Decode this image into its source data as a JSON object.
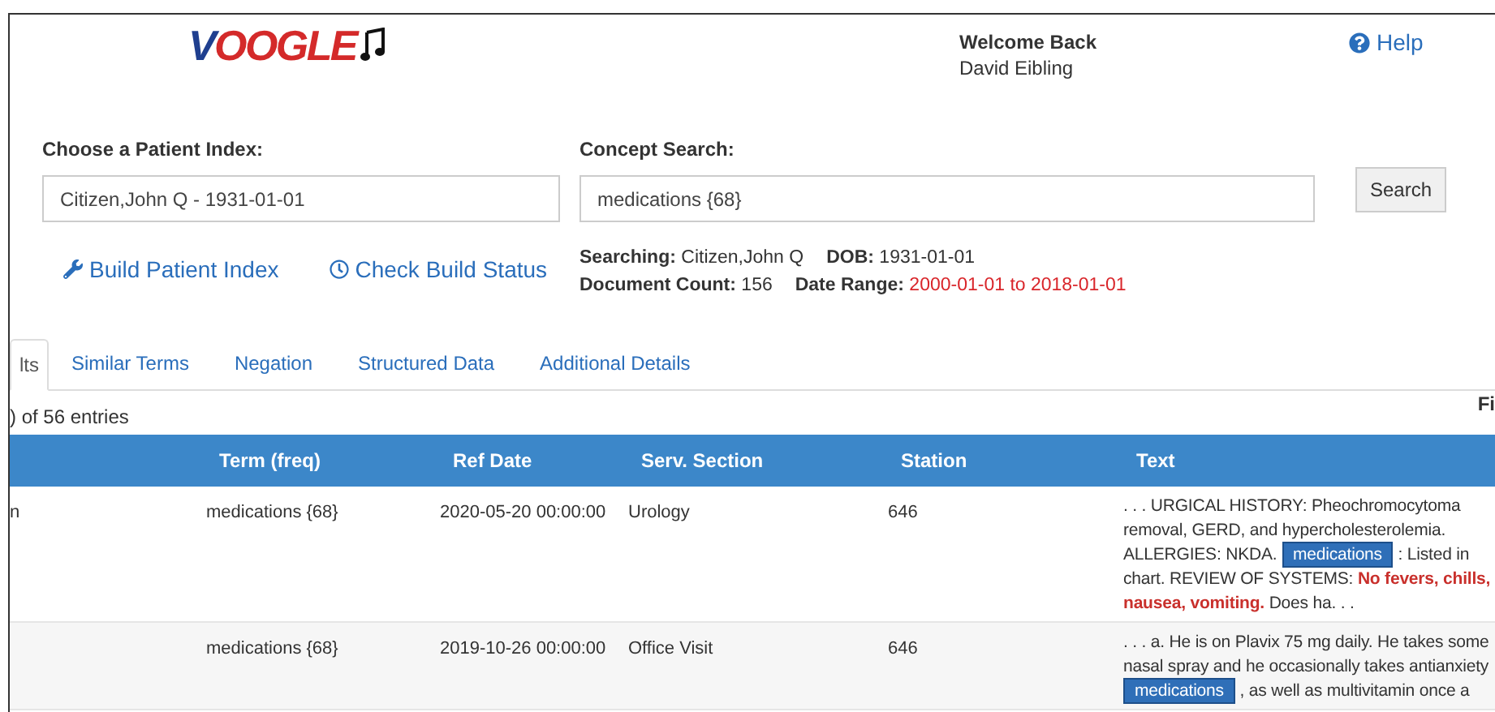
{
  "logo": {
    "text": "VOOGLE"
  },
  "user": {
    "greeting": "Welcome Back",
    "name": "David Eibling"
  },
  "help_link": "Help",
  "patient_index": {
    "label": "Choose a Patient Index:",
    "value": "Citizen,John Q - 1931-01-01"
  },
  "concept_search": {
    "label": "Concept Search:",
    "value": "medications {68}",
    "button": "Search"
  },
  "actions": [
    {
      "kind": "wrench",
      "label": "Build Patient Index"
    },
    {
      "kind": "clock",
      "label": "Check Build Status"
    }
  ],
  "search_info": [
    [
      {
        "label": "Searching:",
        "value": "Citizen,John Q",
        "alert": false
      },
      {
        "label": "DOB:",
        "value": "1931-01-01",
        "alert": false
      }
    ],
    [
      {
        "label": "Document Count:",
        "value": "156",
        "alert": false
      },
      {
        "label": "Date Range:",
        "value": "2000-01-01 to 2018-01-01",
        "alert": true
      }
    ]
  ],
  "tabs": [
    {
      "label": "lts",
      "selected": true
    },
    {
      "label": "Similar Terms",
      "selected": false
    },
    {
      "label": "Negation",
      "selected": false
    },
    {
      "label": "Structured Data",
      "selected": false
    },
    {
      "label": "Additional Details",
      "selected": false
    }
  ],
  "table": {
    "info": ") of 56 entries",
    "filter_label": "Fi",
    "columns": [
      "Term (freq)",
      "Ref Date",
      "Serv. Section",
      "Station",
      "Text"
    ],
    "rows": [
      {
        "column_1": "n",
        "term": "medications {68}",
        "ref_date": "2020-05-20 00:00:00",
        "section": "Urology",
        "station": "646",
        "text": [
          {
            "kind": "plain",
            "text": ". . . URGICAL HISTORY: Pheochromocytoma removal, GERD, and hypercholesterolemia. ALLERGIES: NKDA."
          },
          {
            "kind": "match",
            "text": "medications"
          },
          {
            "kind": "plain",
            "text": ": Listed in chart. REVIEW OF SYSTEMS:"
          },
          {
            "kind": "negation",
            "text": "No fevers, chills, nausea, vomiting."
          },
          {
            "kind": "plain",
            "text": "Does ha. . ."
          }
        ]
      },
      {
        "term": "medications {68}",
        "ref_date": "2019-10-26 00:00:00",
        "section": "Office Visit",
        "station": "646",
        "text": [
          {
            "kind": "plain",
            "text": ". . . a. He is on Plavix 75 mg daily. He takes some nasal spray and he occasionally takes antianxiety"
          },
          {
            "kind": "match",
            "text": "medications"
          },
          {
            "kind": "plain",
            "text": ", as well as multivitamin once a"
          }
        ]
      }
    ]
  }
}
